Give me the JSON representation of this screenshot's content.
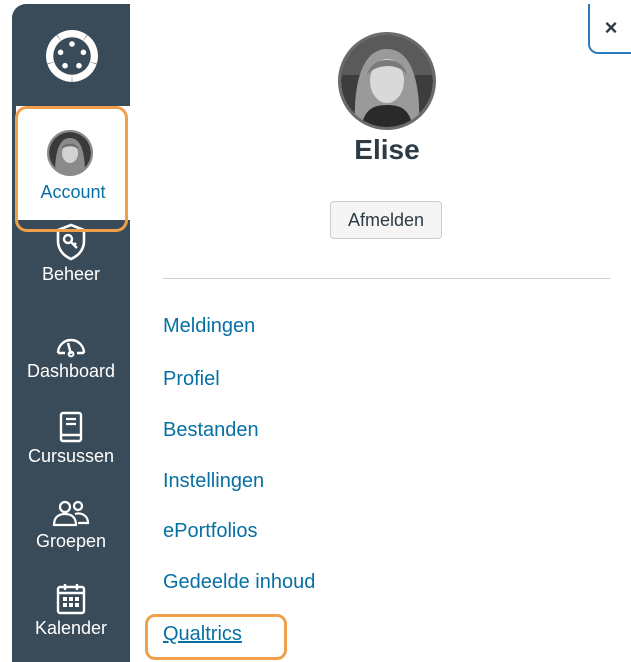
{
  "nav": {
    "items": [
      {
        "label": "Account",
        "icon": "avatar"
      },
      {
        "label": "Beheer",
        "icon": "shield-icon"
      },
      {
        "label": "Dashboard",
        "icon": "dashboard-icon"
      },
      {
        "label": "Cursussen",
        "icon": "book-icon"
      },
      {
        "label": "Groepen",
        "icon": "groups-icon"
      },
      {
        "label": "Kalender",
        "icon": "calendar-icon"
      }
    ],
    "active_color": "#0770a3",
    "background": "#394b58"
  },
  "tray": {
    "close_label": "×",
    "user_name": "Elise",
    "logout_label": "Afmelden",
    "links": [
      {
        "label": "Meldingen"
      },
      {
        "label": "Profiel"
      },
      {
        "label": "Bestanden"
      },
      {
        "label": "Instellingen"
      },
      {
        "label": "ePortfolios"
      },
      {
        "label": "Gedeelde inhoud"
      },
      {
        "label": "Qualtrics",
        "active": true
      }
    ],
    "link_color": "#0770a3",
    "highlight_color": "#f0a04b"
  }
}
